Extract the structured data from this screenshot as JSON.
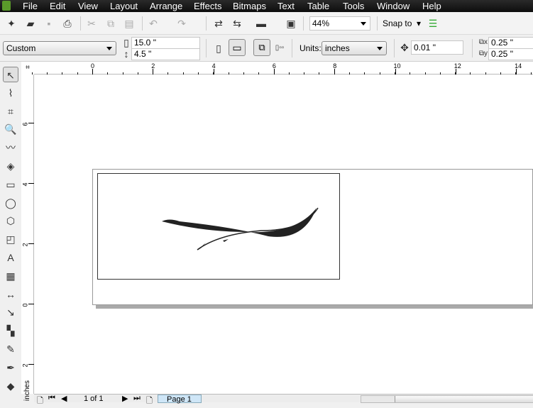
{
  "menu": [
    "File",
    "Edit",
    "View",
    "Layout",
    "Arrange",
    "Effects",
    "Bitmaps",
    "Text",
    "Table",
    "Tools",
    "Window",
    "Help"
  ],
  "toolbar": {
    "zoom": "44%",
    "snap_to": "Snap to",
    "icons": [
      "new-icon",
      "open-icon",
      "save-icon",
      "print-icon",
      "cut-icon",
      "copy-icon",
      "paste-icon",
      "undo-icon",
      "redo-icon",
      "import-icon",
      "export-icon",
      "application-launcher-icon",
      "welcome-screen-icon"
    ]
  },
  "property_bar": {
    "paper_size": "Custom",
    "width": "15.0 \"",
    "height": "4.5 \"",
    "units_label": "Units:",
    "units": "inches",
    "nudge": "0.01 \"",
    "dup_x": "0.25 \"",
    "dup_y": "0.25 \""
  },
  "rulers": {
    "horizontal": [
      "0",
      "2",
      "4",
      "6",
      "8",
      "10",
      "12",
      "14"
    ],
    "vertical": [
      "6",
      "4",
      "2",
      "0",
      "2"
    ],
    "unit": "inches"
  },
  "toolbox": [
    "pick-tool",
    "shape-tool",
    "crop-tool",
    "zoom-tool",
    "freehand-tool",
    "smart-fill-tool",
    "rectangle-tool",
    "ellipse-tool",
    "polygon-tool",
    "basic-shapes-tool",
    "text-tool",
    "table-tool",
    "dimension-tool",
    "connector-tool",
    "blend-tool",
    "eyedropper-tool",
    "outline-tool",
    "fill-tool"
  ],
  "status": {
    "page_count": "1 of 1",
    "page_tab": "Page 1"
  }
}
